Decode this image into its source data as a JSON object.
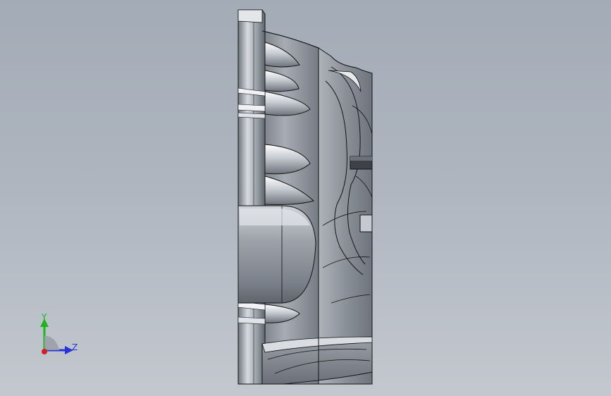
{
  "viewport": {
    "background_top": "#a3abb6",
    "background_bottom": "#c3c8cf",
    "part_color": "#8d939c",
    "edge_color": "#141414"
  },
  "triad": {
    "y_label": "Y",
    "z_label": "Z",
    "y_color": "#1db41d",
    "z_color": "#2833d6",
    "x_color": "#d12020"
  }
}
